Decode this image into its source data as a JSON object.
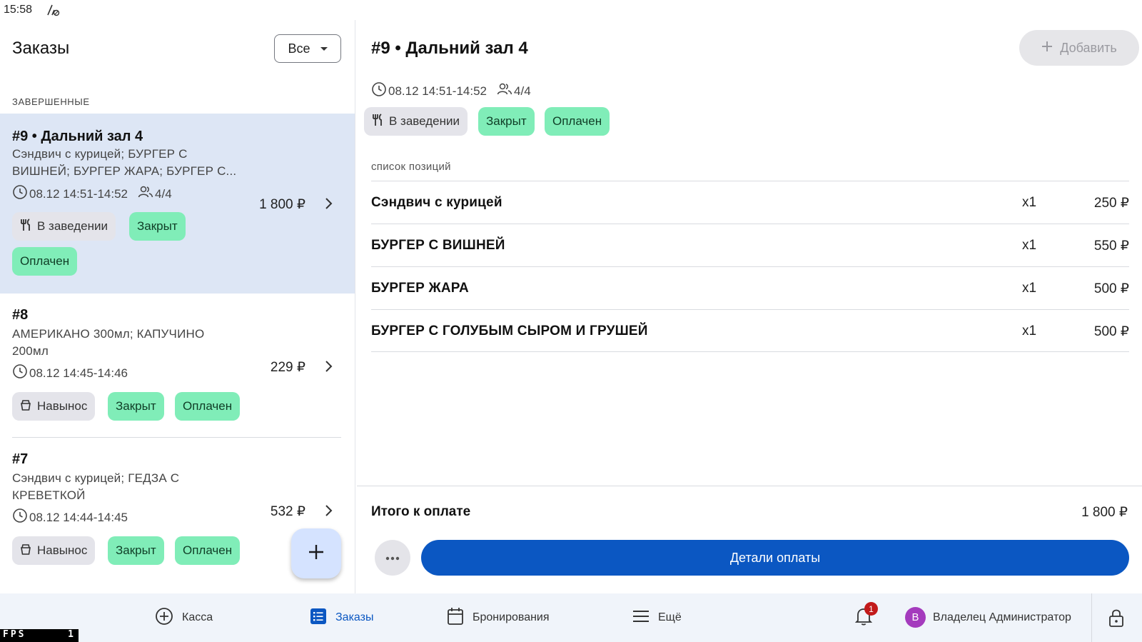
{
  "status": {
    "time": "15:58"
  },
  "orders_pane": {
    "title": "Заказы",
    "filter": "Все",
    "section": "ЗАВЕРШЕННЫЕ",
    "orders": [
      {
        "num": "#9 • Дальний зал 4",
        "items": "Сэндвич с курицей; БУРГЕР С ВИШНЕЙ; БУРГЕР ЖАРА; БУРГЕР С...",
        "time": "08.12 14:51-14:52",
        "guests": "4/4",
        "price": "1 800 ₽",
        "type": "В заведении",
        "status": "Закрыт",
        "payment": "Оплачен"
      },
      {
        "num": "#8",
        "items": "АМЕРИКАНО 300мл; КАПУЧИНО 200мл",
        "time": "08.12 14:45-14:46",
        "price": "229 ₽",
        "type": "Навынос",
        "status": "Закрыт",
        "payment": "Оплачен"
      },
      {
        "num": "#7",
        "items": "Сэндвич с курицей; ГЕДЗА С КРЕВЕТКОЙ",
        "time": "08.12 14:44-14:45",
        "price": "532 ₽",
        "type": "Навынос",
        "status": "Закрыт",
        "payment": "Оплачен"
      }
    ]
  },
  "detail": {
    "title": "#9 • Дальний зал 4",
    "add_label": "Добавить",
    "time": "08.12 14:51-14:52",
    "guests": "4/4",
    "type": "В заведении",
    "status": "Закрыт",
    "payment": "Оплачен",
    "list_label": "список позиций",
    "positions": [
      {
        "name": "Сэндвич с курицей",
        "qty": "x1",
        "sum": "250 ₽"
      },
      {
        "name": "БУРГЕР С ВИШНЕЙ",
        "qty": "x1",
        "sum": "550 ₽"
      },
      {
        "name": "БУРГЕР ЖАРА",
        "qty": "x1",
        "sum": "500 ₽"
      },
      {
        "name": "БУРГЕР С ГОЛУБЫМ СЫРОМ И ГРУШЕЙ",
        "qty": "x1",
        "sum": "500 ₽"
      }
    ],
    "total_label": "Итого к оплате",
    "total_value": "1 800 ₽",
    "pay_label": "Детали оплаты"
  },
  "nav": {
    "kassa": "Касса",
    "orders": "Заказы",
    "bookings": "Бронирования",
    "more": "Ещё",
    "notifications_count": "1",
    "user_initial": "В",
    "user_name": "Владелец Администратор"
  },
  "fps": {
    "label": "FPS",
    "value": "1"
  },
  "colors": {
    "accent": "#0b57c2",
    "selected_bg": "#dde6f5",
    "chip_green": "#80edb8",
    "chip_grey": "#e4e4ea",
    "badge": "#c21a1a"
  }
}
